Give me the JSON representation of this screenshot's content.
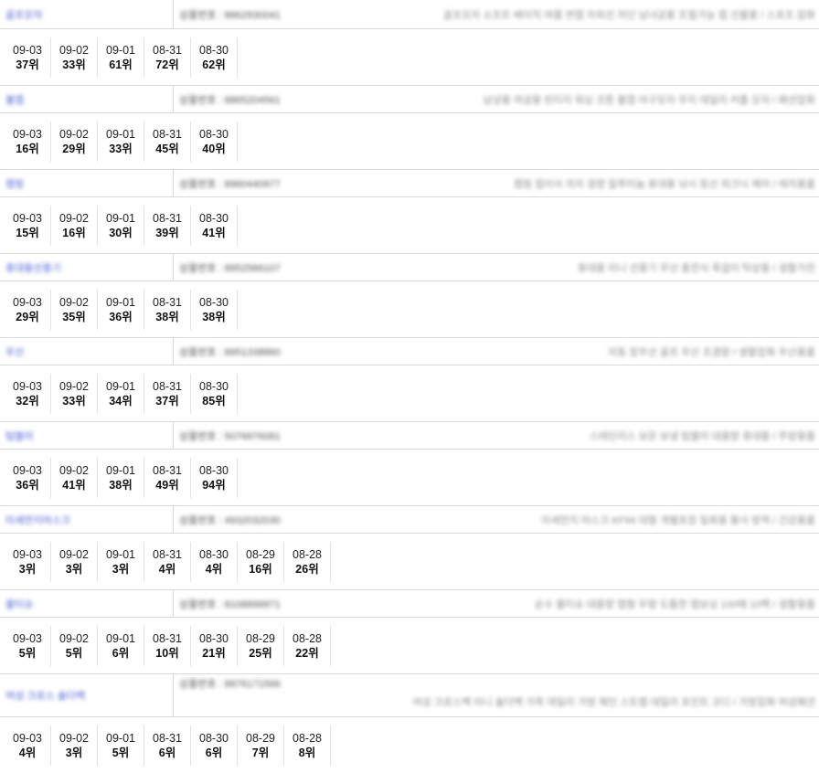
{
  "keywords": [
    {
      "name": "골프모자",
      "code": "상품번호 : 8862930041",
      "desc": "골프모자 소프트 베이직 여름 썬캡 자외선 차단 남녀공용 조절가능 캡 선물용 / 스포츠 잡화",
      "ranks": [
        {
          "date": "09-03",
          "rank": "37위"
        },
        {
          "date": "09-02",
          "rank": "33위"
        },
        {
          "date": "09-01",
          "rank": "61위"
        },
        {
          "date": "08-31",
          "rank": "72위"
        },
        {
          "date": "08-30",
          "rank": "62위"
        }
      ]
    },
    {
      "name": "볼캡",
      "code": "상품번호 : 8865204561",
      "desc": "남성용 여성용 빈티지 워싱 코튼 볼캡 야구모자 무지 데일리 커플 모자 / 패션잡화",
      "ranks": [
        {
          "date": "09-03",
          "rank": "16위"
        },
        {
          "date": "09-02",
          "rank": "29위"
        },
        {
          "date": "09-01",
          "rank": "33위"
        },
        {
          "date": "08-31",
          "rank": "45위"
        },
        {
          "date": "08-30",
          "rank": "40위"
        }
      ]
    },
    {
      "name": "캠핑",
      "code": "상품번호 : 8960440977",
      "desc": "캠핑 접이식 의자 경량 알루미늄 휴대용 낚시 등산 피크닉 체어 / 레저용품",
      "ranks": [
        {
          "date": "09-03",
          "rank": "15위"
        },
        {
          "date": "09-02",
          "rank": "16위"
        },
        {
          "date": "09-01",
          "rank": "30위"
        },
        {
          "date": "08-31",
          "rank": "39위"
        },
        {
          "date": "08-30",
          "rank": "41위"
        }
      ]
    },
    {
      "name": "휴대용선풍기",
      "code": "상품번호 : 8952566107",
      "desc": "휴대용 미니 선풍기 무선 충전식 목걸이 탁상용 / 생활가전",
      "ranks": [
        {
          "date": "09-03",
          "rank": "29위"
        },
        {
          "date": "09-02",
          "rank": "35위"
        },
        {
          "date": "09-01",
          "rank": "36위"
        },
        {
          "date": "08-31",
          "rank": "38위"
        },
        {
          "date": "08-30",
          "rank": "38위"
        }
      ]
    },
    {
      "name": "우산",
      "code": "상품번호 : 8951338860",
      "desc": "자동 장우산 골프 우산 초경량 / 생활잡화 우산용품",
      "ranks": [
        {
          "date": "09-03",
          "rank": "32위"
        },
        {
          "date": "09-02",
          "rank": "33위"
        },
        {
          "date": "09-01",
          "rank": "34위"
        },
        {
          "date": "08-31",
          "rank": "37위"
        },
        {
          "date": "08-30",
          "rank": "85위"
        }
      ]
    },
    {
      "name": "텀블러",
      "code": "상품번호 : 5076976081",
      "desc": "스테인리스 보온 보냉 텀블러 대용량 휴대용 / 주방용품",
      "ranks": [
        {
          "date": "09-03",
          "rank": "36위"
        },
        {
          "date": "09-02",
          "rank": "41위"
        },
        {
          "date": "09-01",
          "rank": "38위"
        },
        {
          "date": "08-31",
          "rank": "49위"
        },
        {
          "date": "08-30",
          "rank": "94위"
        }
      ]
    },
    {
      "name": "미세먼지마스크",
      "code": "상품번호 : 4932032030",
      "desc": "미세먼지 마스크 KF94 대형 개별포장 일회용 황사 방역 / 건강용품",
      "ranks": [
        {
          "date": "09-03",
          "rank": "3위"
        },
        {
          "date": "09-02",
          "rank": "3위"
        },
        {
          "date": "09-01",
          "rank": "3위"
        },
        {
          "date": "08-31",
          "rank": "4위"
        },
        {
          "date": "08-30",
          "rank": "4위"
        },
        {
          "date": "08-29",
          "rank": "16위"
        },
        {
          "date": "08-28",
          "rank": "26위"
        }
      ]
    },
    {
      "name": "물티슈",
      "code": "상품번호 : 8108899971",
      "desc": "순수 물티슈 대용량 캡형 무향 도톰한 엠보싱 100매 10팩 / 생활용품",
      "ranks": [
        {
          "date": "09-03",
          "rank": "5위"
        },
        {
          "date": "09-02",
          "rank": "5위"
        },
        {
          "date": "09-01",
          "rank": "6위"
        },
        {
          "date": "08-31",
          "rank": "10위"
        },
        {
          "date": "08-30",
          "rank": "21위"
        },
        {
          "date": "08-29",
          "rank": "25위"
        },
        {
          "date": "08-28",
          "rank": "22위"
        }
      ]
    },
    {
      "name": "여성 크로스 숄더백",
      "code": "상품번호 : 8876171566",
      "desc": "여성 크로스백 미니 숄더백 가죽 데일리 가방 체인 스트랩 데일리 포인트 코디 / 가방잡화 여성패션",
      "ranks": [
        {
          "date": "09-03",
          "rank": "4위"
        },
        {
          "date": "09-02",
          "rank": "3위"
        },
        {
          "date": "09-01",
          "rank": "5위"
        },
        {
          "date": "08-31",
          "rank": "6위"
        },
        {
          "date": "08-30",
          "rank": "6위"
        },
        {
          "date": "08-29",
          "rank": "7위"
        },
        {
          "date": "08-28",
          "rank": "8위"
        }
      ]
    }
  ]
}
